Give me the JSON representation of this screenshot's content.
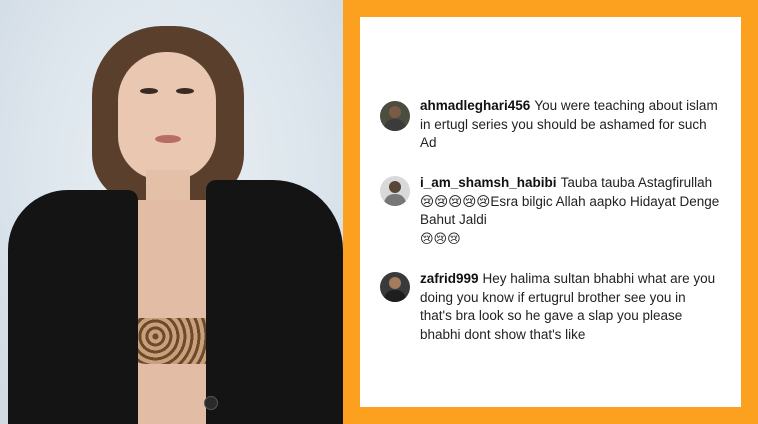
{
  "colors": {
    "frame": "#fca11f",
    "card": "#ffffff",
    "text": "#222222"
  },
  "comments": [
    {
      "username": "ahmadleghari456",
      "text": "You were teaching about islam in ertugl series you should be ashamed for such Ad",
      "emoji": ""
    },
    {
      "username": "i_am_shamsh_habibi",
      "text": "Tauba tauba Astagfirullah 😢😢😢😢😢Esra bilgic Allah aapko Hidayat Denge Bahut Jaldi",
      "emoji": "😢😢😢"
    },
    {
      "username": "zafrid999",
      "text": "Hey halima sultan bhabhi what are you doing you know if ertugrul brother see you in that's bra look so he gave a slap you please bhabhi dont show that's like",
      "emoji": ""
    }
  ]
}
